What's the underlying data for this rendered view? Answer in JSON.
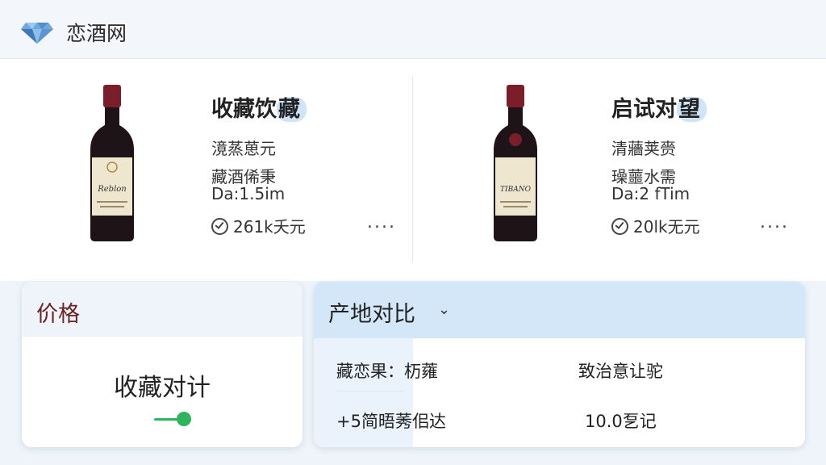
{
  "header": {
    "site_name": "恋酒网",
    "logo_icon": "diamond-logo-icon"
  },
  "products": [
    {
      "title_prefix": "收藏饮",
      "title_highlight": "藏",
      "line1": "滰蒸葸元",
      "line2": "藏酒俙秉",
      "line3": "Da:1.5im",
      "price": "261k夭元",
      "label_text": "Reblon",
      "more_label": "...."
    },
    {
      "title_prefix": "启试对",
      "title_highlight": "望",
      "line1": "清蘠荚赍",
      "line2": "璪蘁水需",
      "line3": "Da:2 fTim",
      "price": "20lk无元",
      "label_text": "TIBANO",
      "more_label": "...."
    }
  ],
  "price_panel": {
    "header": "价格",
    "center_label": "收藏对计",
    "toggle_on": true
  },
  "compare_panel": {
    "header": "产地对比",
    "dropdown_icon": "chevron-down-icon",
    "row1_left": "藏恋果：杤蕹",
    "row1_right": "致治意让驼",
    "row2_left": "+5简晤莠佀达",
    "row2_right": "10.0乭记"
  },
  "colors": {
    "accent_blue": "#d3e7f8",
    "wine_red": "#6a2222",
    "toggle_green": "#2fb35d"
  }
}
